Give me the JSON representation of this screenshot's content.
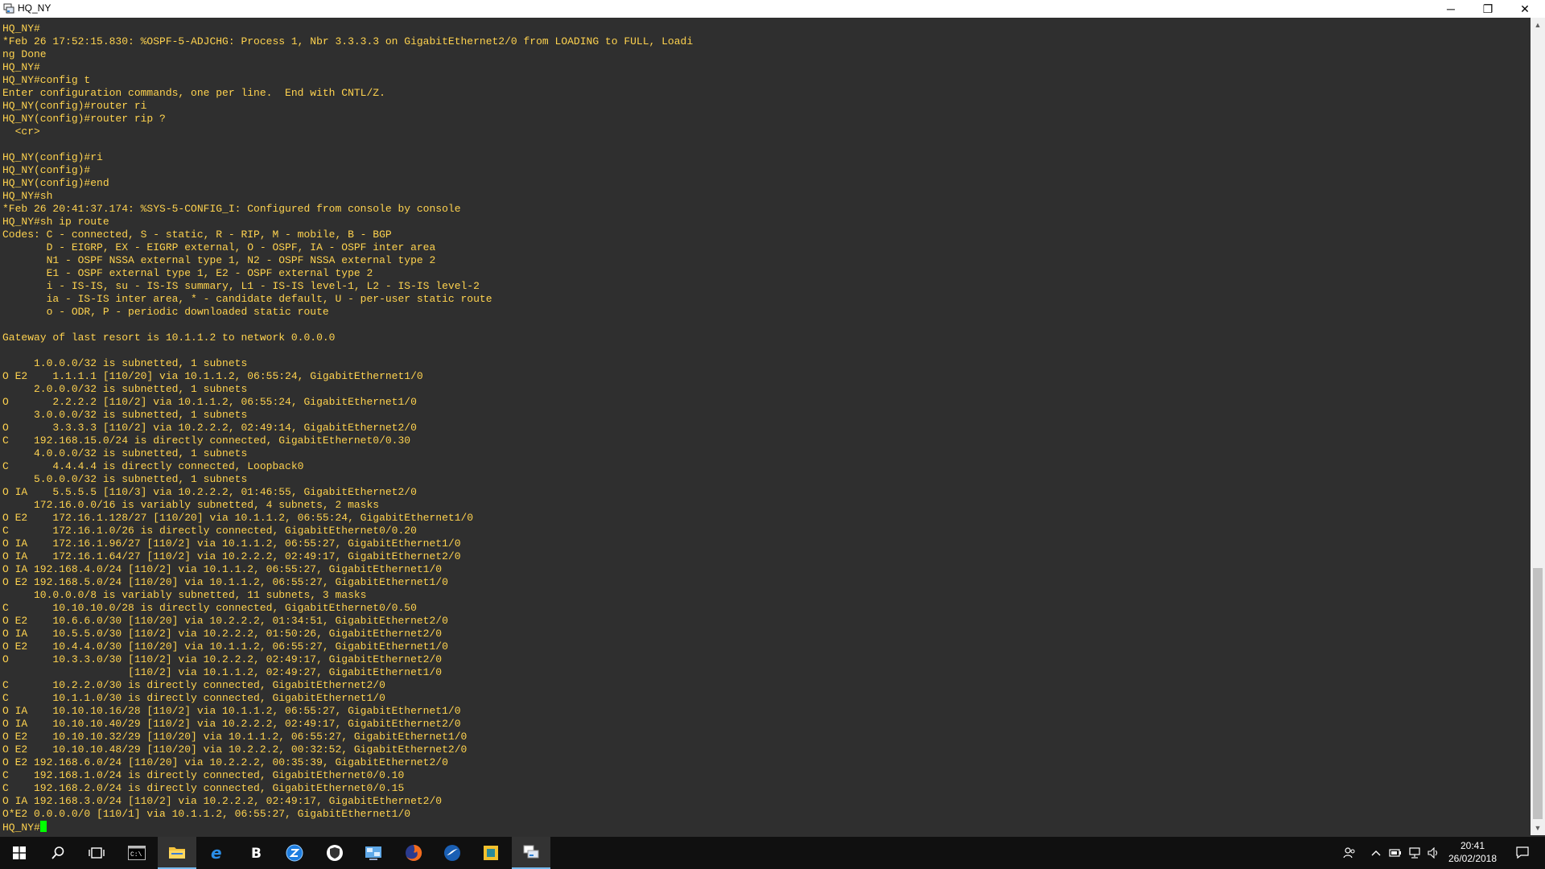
{
  "window": {
    "title": "HQ_NY",
    "minimize_glyph": "─",
    "restore_glyph": "❐",
    "close_glyph": "✕"
  },
  "terminal": {
    "lines": [
      "HQ_NY#",
      "*Feb 26 17:52:15.830: %OSPF-5-ADJCHG: Process 1, Nbr 3.3.3.3 on GigabitEthernet2/0 from LOADING to FULL, Loadi",
      "ng Done",
      "HQ_NY#",
      "HQ_NY#config t",
      "Enter configuration commands, one per line.  End with CNTL/Z.",
      "HQ_NY(config)#router ri",
      "HQ_NY(config)#router rip ?",
      "  <cr>",
      "",
      "HQ_NY(config)#ri",
      "HQ_NY(config)#",
      "HQ_NY(config)#end",
      "HQ_NY#sh",
      "*Feb 26 20:41:37.174: %SYS-5-CONFIG_I: Configured from console by console",
      "HQ_NY#sh ip route",
      "Codes: C - connected, S - static, R - RIP, M - mobile, B - BGP",
      "       D - EIGRP, EX - EIGRP external, O - OSPF, IA - OSPF inter area",
      "       N1 - OSPF NSSA external type 1, N2 - OSPF NSSA external type 2",
      "       E1 - OSPF external type 1, E2 - OSPF external type 2",
      "       i - IS-IS, su - IS-IS summary, L1 - IS-IS level-1, L2 - IS-IS level-2",
      "       ia - IS-IS inter area, * - candidate default, U - per-user static route",
      "       o - ODR, P - periodic downloaded static route",
      "",
      "Gateway of last resort is 10.1.1.2 to network 0.0.0.0",
      "",
      "     1.0.0.0/32 is subnetted, 1 subnets",
      "O E2    1.1.1.1 [110/20] via 10.1.1.2, 06:55:24, GigabitEthernet1/0",
      "     2.0.0.0/32 is subnetted, 1 subnets",
      "O       2.2.2.2 [110/2] via 10.1.1.2, 06:55:24, GigabitEthernet1/0",
      "     3.0.0.0/32 is subnetted, 1 subnets",
      "O       3.3.3.3 [110/2] via 10.2.2.2, 02:49:14, GigabitEthernet2/0",
      "C    192.168.15.0/24 is directly connected, GigabitEthernet0/0.30",
      "     4.0.0.0/32 is subnetted, 1 subnets",
      "C       4.4.4.4 is directly connected, Loopback0",
      "     5.0.0.0/32 is subnetted, 1 subnets",
      "O IA    5.5.5.5 [110/3] via 10.2.2.2, 01:46:55, GigabitEthernet2/0",
      "     172.16.0.0/16 is variably subnetted, 4 subnets, 2 masks",
      "O E2    172.16.1.128/27 [110/20] via 10.1.1.2, 06:55:24, GigabitEthernet1/0",
      "C       172.16.1.0/26 is directly connected, GigabitEthernet0/0.20",
      "O IA    172.16.1.96/27 [110/2] via 10.1.1.2, 06:55:27, GigabitEthernet1/0",
      "O IA    172.16.1.64/27 [110/2] via 10.2.2.2, 02:49:17, GigabitEthernet2/0",
      "O IA 192.168.4.0/24 [110/2] via 10.1.1.2, 06:55:27, GigabitEthernet1/0",
      "O E2 192.168.5.0/24 [110/20] via 10.1.1.2, 06:55:27, GigabitEthernet1/0",
      "     10.0.0.0/8 is variably subnetted, 11 subnets, 3 masks",
      "C       10.10.10.0/28 is directly connected, GigabitEthernet0/0.50",
      "O E2    10.6.6.0/30 [110/20] via 10.2.2.2, 01:34:51, GigabitEthernet2/0",
      "O IA    10.5.5.0/30 [110/2] via 10.2.2.2, 01:50:26, GigabitEthernet2/0",
      "O E2    10.4.4.0/30 [110/20] via 10.1.1.2, 06:55:27, GigabitEthernet1/0",
      "O       10.3.3.0/30 [110/2] via 10.2.2.2, 02:49:17, GigabitEthernet2/0",
      "                    [110/2] via 10.1.1.2, 02:49:27, GigabitEthernet1/0",
      "C       10.2.2.0/30 is directly connected, GigabitEthernet2/0",
      "C       10.1.1.0/30 is directly connected, GigabitEthernet1/0",
      "O IA    10.10.10.16/28 [110/2] via 10.1.1.2, 06:55:27, GigabitEthernet1/0",
      "O IA    10.10.10.40/29 [110/2] via 10.2.2.2, 02:49:17, GigabitEthernet2/0",
      "O E2    10.10.10.32/29 [110/20] via 10.1.1.2, 06:55:27, GigabitEthernet1/0",
      "O E2    10.10.10.48/29 [110/20] via 10.2.2.2, 00:32:52, GigabitEthernet2/0",
      "O E2 192.168.6.0/24 [110/20] via 10.2.2.2, 00:35:39, GigabitEthernet2/0",
      "C    192.168.1.0/24 is directly connected, GigabitEthernet0/0.10",
      "C    192.168.2.0/24 is directly connected, GigabitEthernet0/0.15",
      "O IA 192.168.3.0/24 [110/2] via 10.2.2.2, 02:49:17, GigabitEthernet2/0",
      "O*E2 0.0.0.0/0 [110/1] via 10.1.1.2, 06:55:27, GigabitEthernet1/0"
    ],
    "prompt": "HQ_NY#",
    "text_color": "#ffd34f",
    "background": "#2f2f2f",
    "cursor_color": "#00ff00"
  },
  "taskbar": {
    "apps": [
      "windows-start-icon",
      "search-icon",
      "task-view-icon",
      "command-prompt-icon",
      "file-explorer-icon",
      "edge-browser-icon",
      "b-app-icon",
      "blue-circle-app-icon",
      "shield-app-icon",
      "network-app-icon",
      "firefox-icon",
      "wireshark-icon",
      "yellow-app-icon",
      "terminal-session-icon"
    ],
    "clock": {
      "time": "20:41",
      "date": "26/02/2018"
    },
    "accent": "#76b9ed"
  }
}
